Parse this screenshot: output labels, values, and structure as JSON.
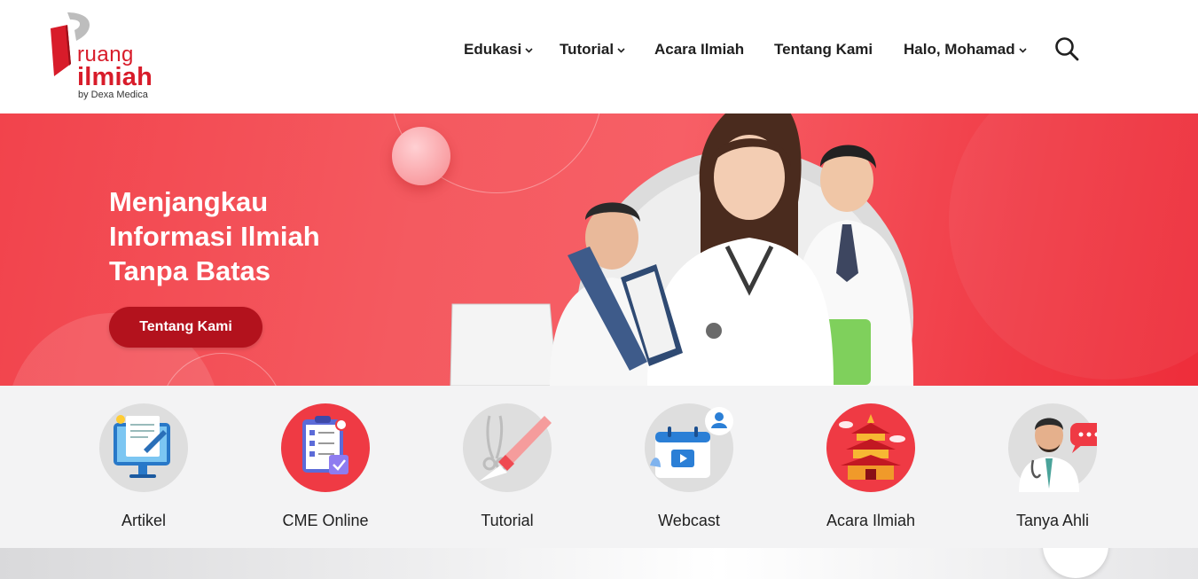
{
  "brand": {
    "name_line1": "ruang",
    "name_line2": "ilmiah",
    "tagline": "by Dexa Medica",
    "color": "#d81c2a"
  },
  "nav": {
    "items": [
      {
        "label": "Edukasi",
        "has_dropdown": true
      },
      {
        "label": "Tutorial",
        "has_dropdown": true
      },
      {
        "label": "Acara Ilmiah",
        "has_dropdown": false
      },
      {
        "label": "Tentang Kami",
        "has_dropdown": false
      },
      {
        "label": "Halo, Mohamad",
        "has_dropdown": true
      }
    ],
    "search_icon": "search-icon"
  },
  "hero": {
    "title_lines": [
      "Menjangkau",
      "Informasi Ilmiah",
      "Tanpa Batas"
    ],
    "button_label": "Tentang Kami",
    "accent": "#f24a52",
    "button_color": "#b3121d"
  },
  "categories": [
    {
      "label": "Artikel",
      "icon": "article-monitor-icon"
    },
    {
      "label": "CME Online",
      "icon": "cme-checklist-icon"
    },
    {
      "label": "Tutorial",
      "icon": "scalpel-icon"
    },
    {
      "label": "Webcast",
      "icon": "video-calendar-icon"
    },
    {
      "label": "Acara Ilmiah",
      "icon": "pagoda-event-icon"
    },
    {
      "label": "Tanya Ahli",
      "icon": "doctor-chat-icon"
    }
  ]
}
